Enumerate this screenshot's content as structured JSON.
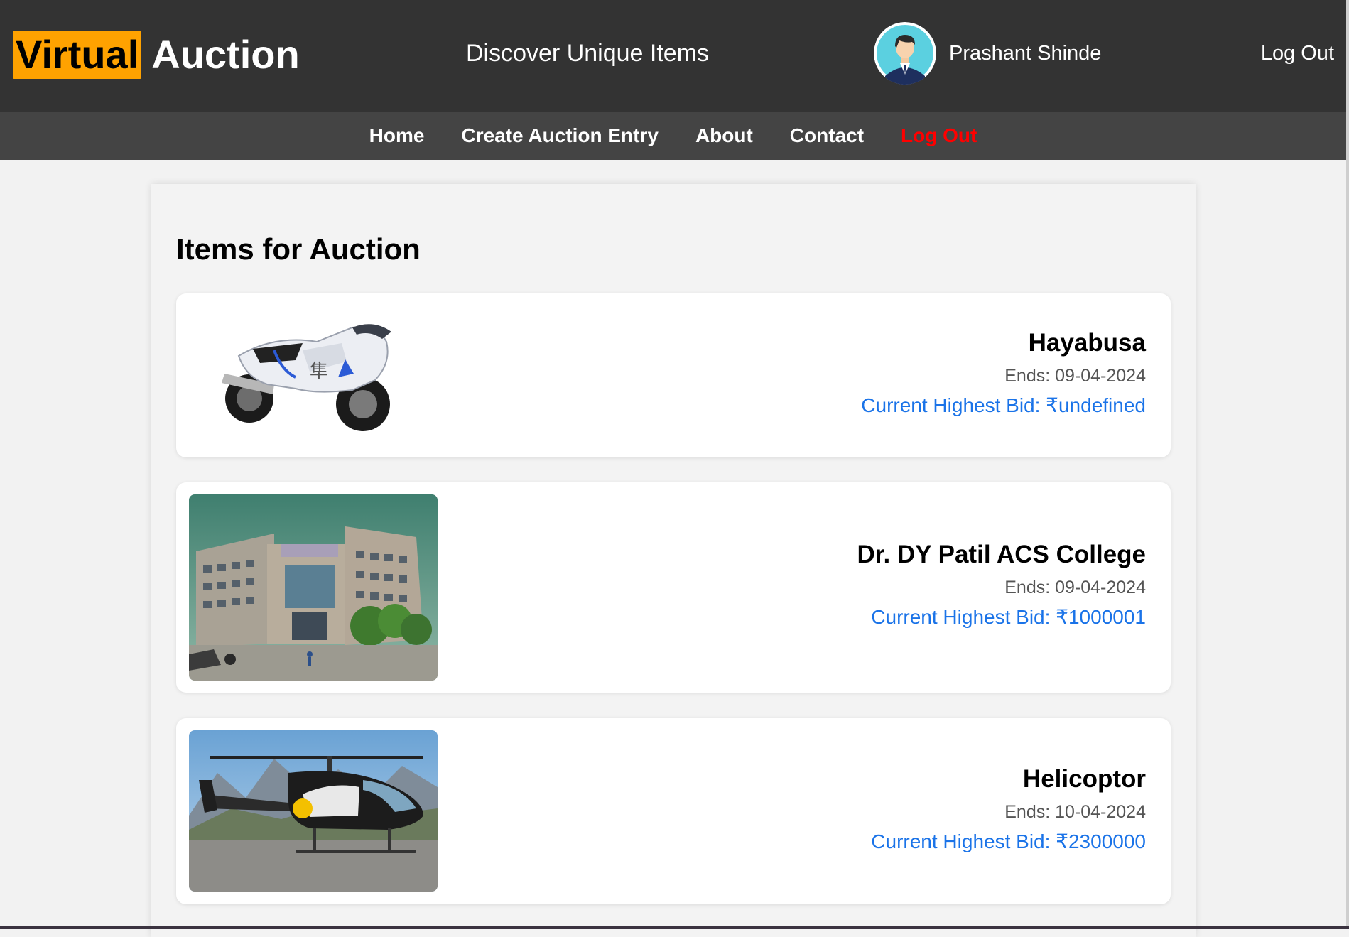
{
  "header": {
    "logo_highlight": "Virtual",
    "logo_rest": "Auction",
    "tagline": "Discover Unique Items",
    "user_name": "Prashant Shinde",
    "logout_label": "Log Out"
  },
  "nav": {
    "items": [
      {
        "label": "Home"
      },
      {
        "label": "Create Auction Entry"
      },
      {
        "label": "About"
      },
      {
        "label": "Contact"
      },
      {
        "label": "Log Out"
      }
    ]
  },
  "main": {
    "title": "Items for Auction",
    "items": [
      {
        "name": "Hayabusa",
        "ends": "Ends: 09-04-2024",
        "bid": "Current Highest Bid: ₹undefined"
      },
      {
        "name": "Dr. DY Patil ACS College",
        "ends": "Ends: 09-04-2024",
        "bid": "Current Highest Bid: ₹1000001"
      },
      {
        "name": "Helicoptor",
        "ends": "Ends: 10-04-2024",
        "bid": "Current Highest Bid: ₹2300000"
      }
    ]
  },
  "colors": {
    "header_bg": "#333333",
    "nav_bg": "#444444",
    "logo_accent": "#ffa200",
    "nav_logout": "#ff0000",
    "bid_text": "#1a73e8"
  },
  "icons": {
    "avatar": "user-avatar-icon",
    "item_images": [
      "motorcycle-image",
      "college-building-image",
      "helicopter-image"
    ]
  }
}
